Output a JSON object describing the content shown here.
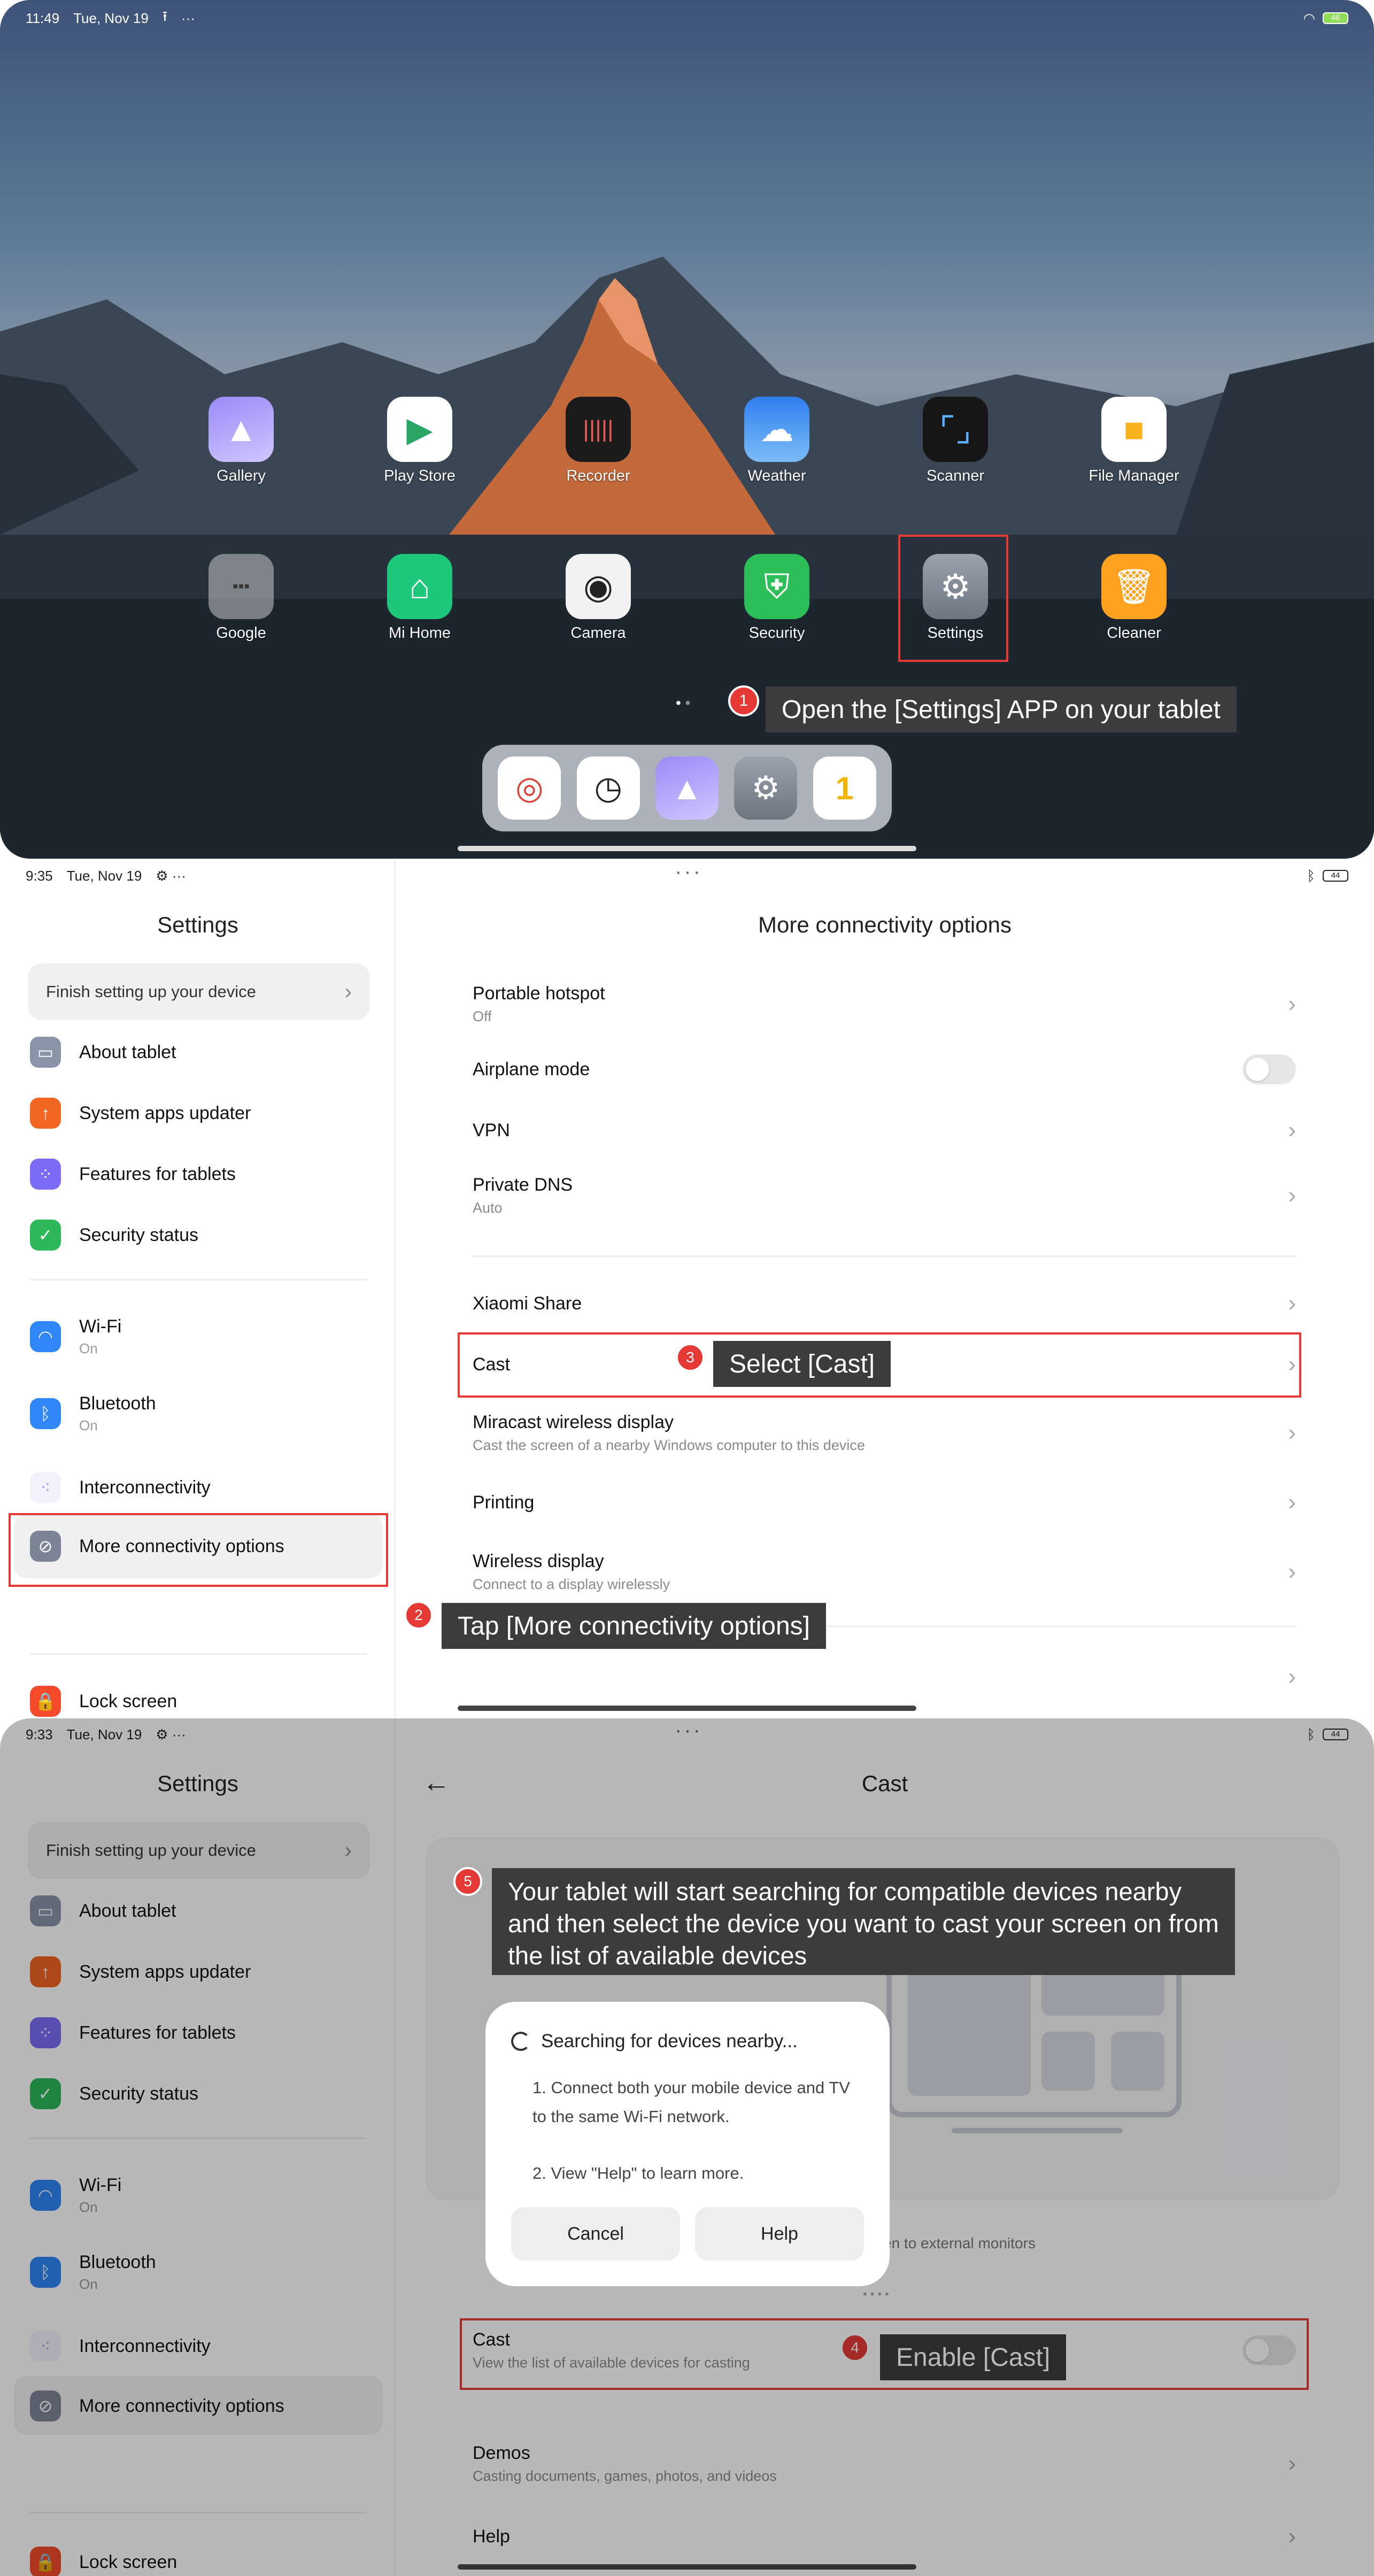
{
  "panel1": {
    "status": {
      "time": "11:49",
      "date": "Tue, Nov 19"
    },
    "apps_row1": [
      {
        "label": "Gallery",
        "icon": "gallery-icon",
        "color": "#8d7cf2"
      },
      {
        "label": "Play Store",
        "icon": "play-store-icon",
        "color": "#ffffff"
      },
      {
        "label": "Recorder",
        "icon": "recorder-icon",
        "color": "#222222"
      },
      {
        "label": "Weather",
        "icon": "weather-icon",
        "color": "#3b8df2"
      },
      {
        "label": "Scanner",
        "icon": "scanner-icon",
        "color": "#1a1a1a"
      },
      {
        "label": "File Manager",
        "icon": "folder-icon",
        "color": "#f9b21c"
      }
    ],
    "apps_row2": [
      {
        "label": "Google",
        "icon": "google-folder-icon",
        "color": "#8a8f95"
      },
      {
        "label": "Mi Home",
        "icon": "mi-home-icon",
        "color": "#1fc77a"
      },
      {
        "label": "Camera",
        "icon": "camera-icon",
        "color": "#f2f2f2"
      },
      {
        "label": "Security",
        "icon": "security-icon",
        "color": "#2cbf57"
      },
      {
        "label": "Settings",
        "icon": "settings-gear-icon",
        "color": "#8a929c"
      },
      {
        "label": "Cleaner",
        "icon": "cleaner-icon",
        "color": "#ffa21f"
      }
    ],
    "dock": [
      "chrome-icon",
      "clock-icon",
      "gallery-icon",
      "settings-gear-icon",
      "one-app-icon"
    ],
    "step1": {
      "num": "1",
      "text": "Open the [Settings] APP on your tablet"
    }
  },
  "settings_sidebar": {
    "title": "Settings",
    "finish": "Finish setting up your device",
    "items": [
      {
        "label": "About tablet",
        "sub": "",
        "color": "#8a94a8"
      },
      {
        "label": "System apps updater",
        "sub": "",
        "color": "#f26522"
      },
      {
        "label": "Features for tablets",
        "sub": "",
        "color": "#7a6cf5"
      },
      {
        "label": "Security status",
        "sub": "",
        "color": "#2db85a"
      },
      {
        "label": "Wi-Fi",
        "sub": "On",
        "color": "#2f86f6"
      },
      {
        "label": "Bluetooth",
        "sub": "On",
        "color": "#2f86f6"
      },
      {
        "label": "Interconnectivity",
        "sub": "",
        "color": "#c3b9f2"
      },
      {
        "label": "More connectivity options",
        "sub": "",
        "color": "#7c8596"
      },
      {
        "label": "Lock screen",
        "sub": "",
        "color": "#f24a2a"
      }
    ]
  },
  "panel2": {
    "status": {
      "time": "9:35",
      "date": "Tue, Nov 19"
    },
    "title": "More connectivity options",
    "rows": [
      {
        "label": "Portable hotspot",
        "sub": "Off"
      },
      {
        "label": "Airplane mode",
        "sub": ""
      },
      {
        "label": "VPN",
        "sub": ""
      },
      {
        "label": "Private DNS",
        "sub": "Auto"
      },
      {
        "label": "Xiaomi Share",
        "sub": ""
      },
      {
        "label": "Cast",
        "sub": ""
      },
      {
        "label": "Miracast wireless display",
        "sub": "Cast the screen of a nearby Windows computer to this device"
      },
      {
        "label": "Printing",
        "sub": ""
      },
      {
        "label": "Wireless display",
        "sub": "Connect to a display wirelessly"
      }
    ],
    "step2": {
      "num": "2",
      "text": "Tap [More connectivity options]"
    },
    "step3": {
      "num": "3",
      "text": "Select [Cast]"
    }
  },
  "panel3": {
    "status": {
      "time": "9:33",
      "date": "Tue, Nov 19"
    },
    "title": "Cast",
    "partial_caption": "en to external monitors",
    "cast_row": {
      "label": "Cast",
      "sub": "View the list of available devices for casting"
    },
    "demos_row": {
      "label": "Demos",
      "sub": "Casting documents, games, photos, and videos"
    },
    "help_row": {
      "label": "Help"
    },
    "dialog": {
      "title": "Searching for devices nearby...",
      "line1": "1. Connect both your mobile device and TV to the same Wi-Fi network.",
      "line2": "2. View \"Help\" to learn more.",
      "cancel": "Cancel",
      "help": "Help"
    },
    "step4": {
      "num": "4",
      "text": "Enable [Cast]"
    },
    "step5": {
      "num": "5",
      "text": "Your tablet will start searching for compatible devices nearby and then select the device you want to cast your screen on from the list of available devices"
    }
  }
}
